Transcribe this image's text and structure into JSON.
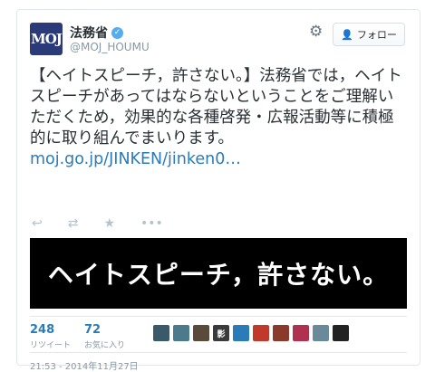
{
  "account": {
    "name": "法務省",
    "handle": "@MOJ_HOUMU",
    "avatar_text": "MOJ",
    "verified_icon": "✓",
    "follow_label": "フォロー"
  },
  "tweet": {
    "text": "【ヘイトスピーチ，許さない。】法務省では，ヘイトスピーチがあってはならないということをご理解いただくため，効果的な各種啓発・広報活動等に積極的に取り組んでまいります。",
    "link": "moj.go.jp/JINKEN/jinken0…"
  },
  "banner": {
    "text": "ヘイトスピーチ，許さない。"
  },
  "stats": {
    "retweets": {
      "count": "248",
      "label": "リツイート"
    },
    "favorites": {
      "count": "72",
      "label": "お気に入り"
    }
  },
  "avatars": [
    {
      "glyph": "",
      "color": "#3a5a6a"
    },
    {
      "glyph": "",
      "color": "#4a7a8c"
    },
    {
      "glyph": "",
      "color": "#5a4a3a"
    },
    {
      "glyph": "影",
      "color": "#3a3a3a"
    },
    {
      "glyph": "",
      "color": "#2b7bb9"
    },
    {
      "glyph": "",
      "color": "#c0392b"
    },
    {
      "glyph": "",
      "color": "#8a3a2a"
    },
    {
      "glyph": "",
      "color": "#b03050"
    },
    {
      "glyph": "",
      "color": "#6a8a9a"
    },
    {
      "glyph": "",
      "color": "#222222"
    }
  ],
  "timestamp": "21:53 - 2014年11月27日"
}
